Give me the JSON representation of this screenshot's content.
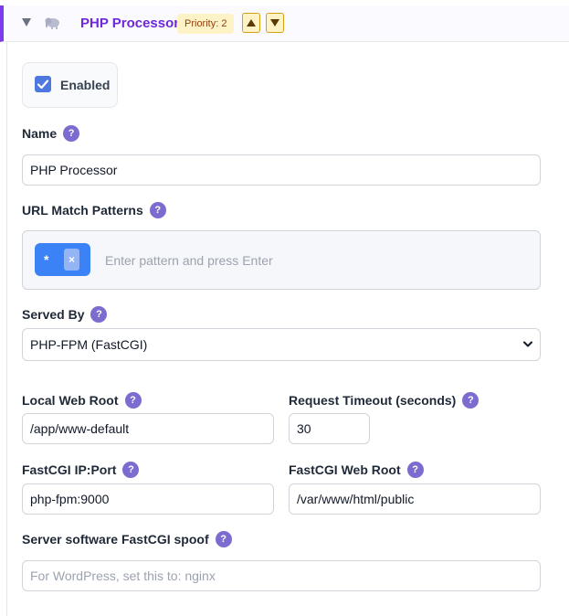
{
  "header": {
    "title": "PHP Processor",
    "priority": "Priority: 2"
  },
  "enabled": {
    "label": "Enabled",
    "checked": true
  },
  "fields": {
    "name": {
      "label": "Name",
      "value": "PHP Processor"
    },
    "url_patterns": {
      "label": "URL Match Patterns",
      "chips": [
        "*"
      ],
      "chip_remove": "×",
      "placeholder": "Enter pattern and press Enter"
    },
    "served_by": {
      "label": "Served By",
      "value": "PHP-FPM (FastCGI)"
    },
    "local_web_root": {
      "label": "Local Web Root",
      "value": "/app/www-default"
    },
    "request_timeout": {
      "label": "Request Timeout (seconds)",
      "value": "30"
    },
    "fastcgi_ip_port": {
      "label": "FastCGI IP:Port",
      "value": "php-fpm:9000"
    },
    "fastcgi_web_root": {
      "label": "FastCGI Web Root",
      "value": "/var/www/html/public"
    },
    "server_software_spoof": {
      "label": "Server software FastCGI spoof",
      "placeholder": "For WordPress, set this to: nginx"
    }
  },
  "help_glyph": "?",
  "colors": {
    "accent": "#7c3aed",
    "title": "#6d28d9",
    "chip": "#3b82f6",
    "checkbox": "#4f77e0",
    "help": "#7c6ccf",
    "badge_bg": "#fef3c7"
  }
}
